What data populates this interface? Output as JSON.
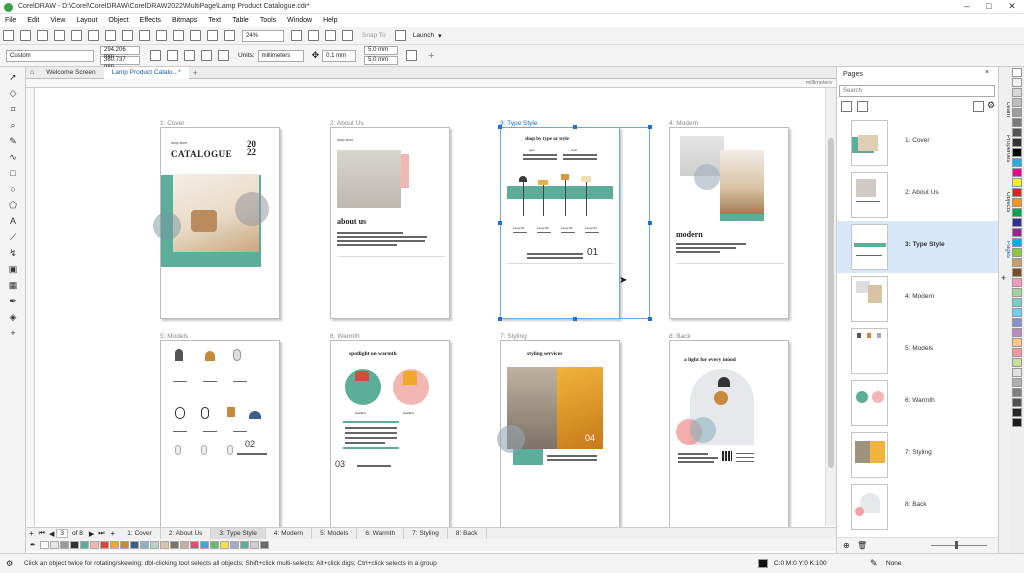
{
  "window": {
    "title": "CorelDRAW - D:\\Corel\\CorelDRAW\\CorelDRAW2022\\MultiPage\\Lamp Product Catalogue.cdr*"
  },
  "menu": [
    "File",
    "Edit",
    "View",
    "Layout",
    "Object",
    "Effects",
    "Bitmaps",
    "Text",
    "Table",
    "Tools",
    "Window",
    "Help"
  ],
  "toolbar": {
    "zoom": "24%",
    "snap_to": "Snap To",
    "launch": "Launch"
  },
  "property_bar": {
    "preset": "Custom",
    "width": "294.206 mm",
    "height": "380.737 mm",
    "units_label": "Units:",
    "units": "millimeters",
    "nudge": "0.1 mm",
    "dup_x": "5.0 mm",
    "dup_y": "5.0 mm"
  },
  "doc_tabs": [
    {
      "label": "Welcome Screen"
    },
    {
      "label": "Lamp Product Catalo...*"
    }
  ],
  "ruler": {
    "unit": "millimeters"
  },
  "pages": [
    {
      "label": "1: Cover",
      "title": "CATALOGUE",
      "year": "20 22",
      "brand": "lamp store"
    },
    {
      "label": "2: About Us",
      "title": "about us",
      "brand": "lamp store"
    },
    {
      "label": "3: Type Style",
      "title": "shop by type or style",
      "number": "01",
      "sub": [
        "type",
        "style"
      ],
      "items": [
        "Lamp 01",
        "Lamp 02",
        "Lamp 03",
        "Lamp 04"
      ]
    },
    {
      "label": "4: Modern",
      "title": "modern"
    },
    {
      "label": "5: Models",
      "number": "02"
    },
    {
      "label": "6: Warmth",
      "title": "spotlight on warmth",
      "number": "03",
      "captions": [
        "headline",
        "headline"
      ]
    },
    {
      "label": "7: Styling",
      "title": "styling services",
      "number": "04"
    },
    {
      "label": "8: Back",
      "title": "a light for every mood"
    }
  ],
  "page_nav": {
    "page_counter": "3",
    "of_pages": "of 8",
    "tabs": [
      "1: Cover",
      "2: About Us",
      "3: Type Style",
      "4: Modern",
      "5: Models",
      "6: Warmth",
      "7: Styling",
      "8: Back"
    ]
  },
  "docker": {
    "title": "Pages",
    "search_placeholder": "Search",
    "items": [
      "1: Cover",
      "2: About Us",
      "3: Type Style",
      "4: Modern",
      "5: Models",
      "6: Warmth",
      "7: Styling",
      "8: Back"
    ]
  },
  "side_tabs": [
    "Learn",
    "Properties",
    "Objects",
    "Pages"
  ],
  "status": {
    "hint": "Click an object twice for rotating/skewing; dbl-clicking tool selects all objects; Shift+click multi-selects; Alt+click digs; Ctrl+click selects in a group",
    "fill": "C:0 M:0 Y:0 K:100",
    "outline": "None"
  },
  "colors": {
    "teal": "#5aae9a",
    "pink": "#f2b7b2",
    "selection": "#1e6fd6"
  }
}
